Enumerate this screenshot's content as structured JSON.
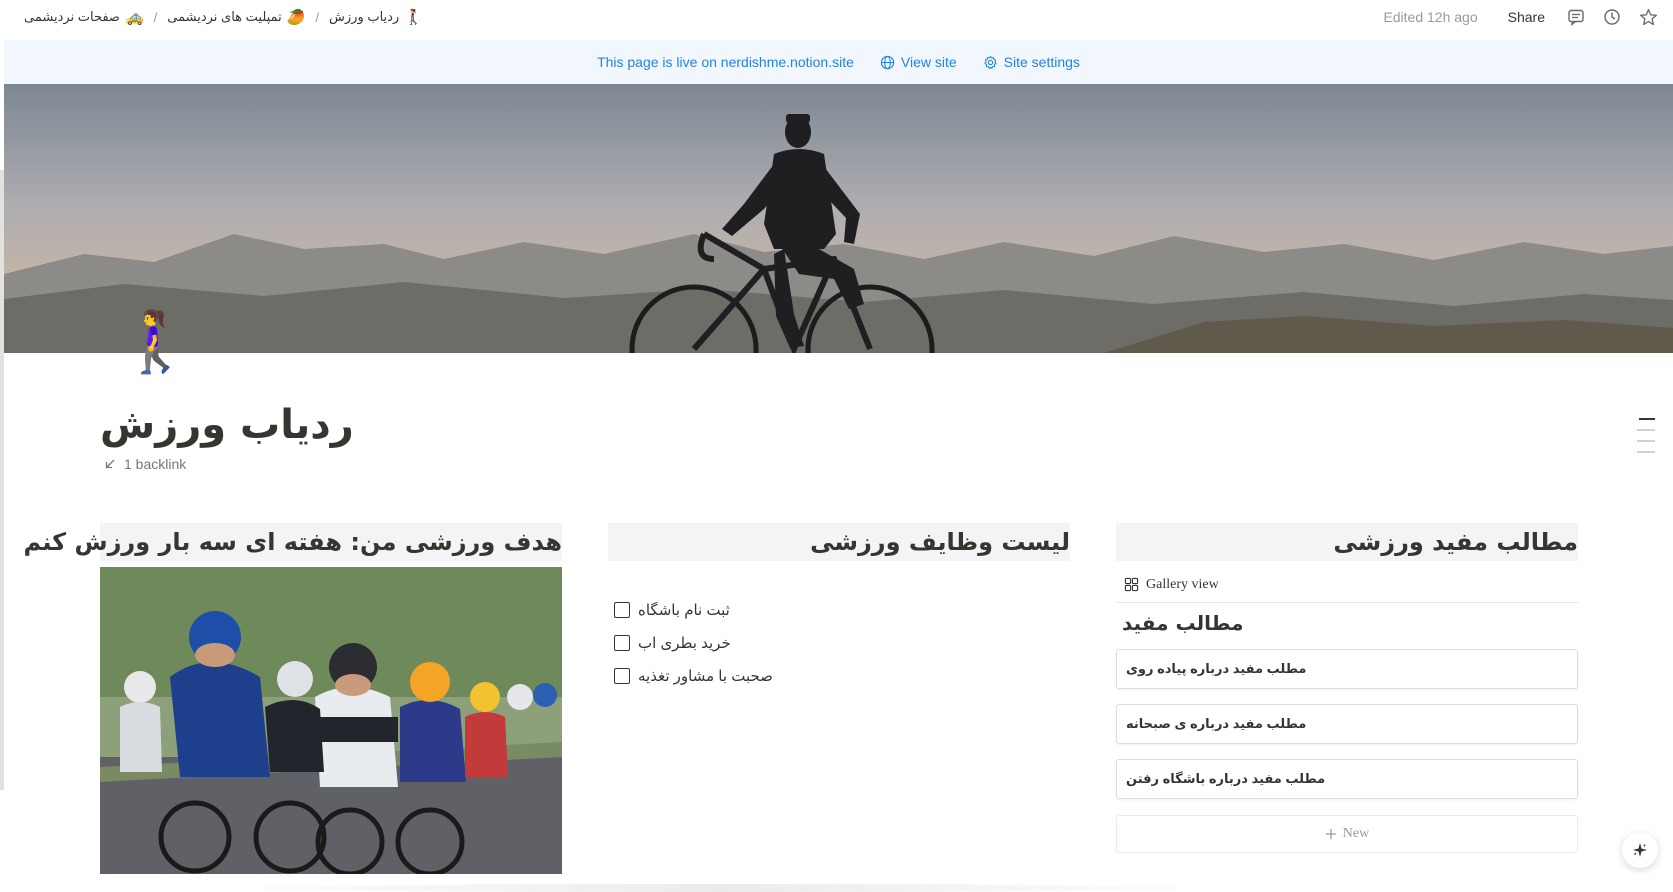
{
  "topbar": {
    "breadcrumbs": [
      {
        "emoji": "🚕",
        "label": "صفحات نردیشمی"
      },
      {
        "emoji": "🥭",
        "label": "تمپلیت های نردیشمی"
      },
      {
        "emoji": "🚶‍♀️",
        "label": "ردیاب ورزش"
      }
    ],
    "separator": "/",
    "edited": "Edited 12h ago",
    "share_label": "Share",
    "icons": [
      "comment-icon",
      "history-icon",
      "star-icon"
    ]
  },
  "banner": {
    "live_text": "This page is live on nerdishme.notion.site",
    "view_site": "View site",
    "site_settings": "Site settings"
  },
  "page": {
    "icon": "🚶‍♀️",
    "title": "ردیاب ورزش",
    "backlink": "1 backlink"
  },
  "columns": {
    "left": {
      "heading": "هدف ورزشی من: هفته ای سه بار ورزش کنم"
    },
    "middle": {
      "heading": "لیست وظایف ورزشی",
      "todos": [
        {
          "label": "ثبت نام باشگاه",
          "checked": false
        },
        {
          "label": "خرید بطری اب",
          "checked": false
        },
        {
          "label": "صحبت با مشاور تغذیه",
          "checked": false
        }
      ]
    },
    "right": {
      "heading": "مطالب مفید ورزشی",
      "view_label": "Gallery view",
      "database_title": "مطالب مفید",
      "cards": [
        "مطلب مفید درباره پیاده روی",
        "مطلب مفید درباره ی صبحانه",
        "مطلب مفید درباره باشگاه رفتن"
      ],
      "new_label": "New"
    }
  },
  "colors": {
    "accent": "#2383e2",
    "banner_bg": "#f1f7fd",
    "heading_bg": "#f4f3f6",
    "text": "#37352f"
  }
}
